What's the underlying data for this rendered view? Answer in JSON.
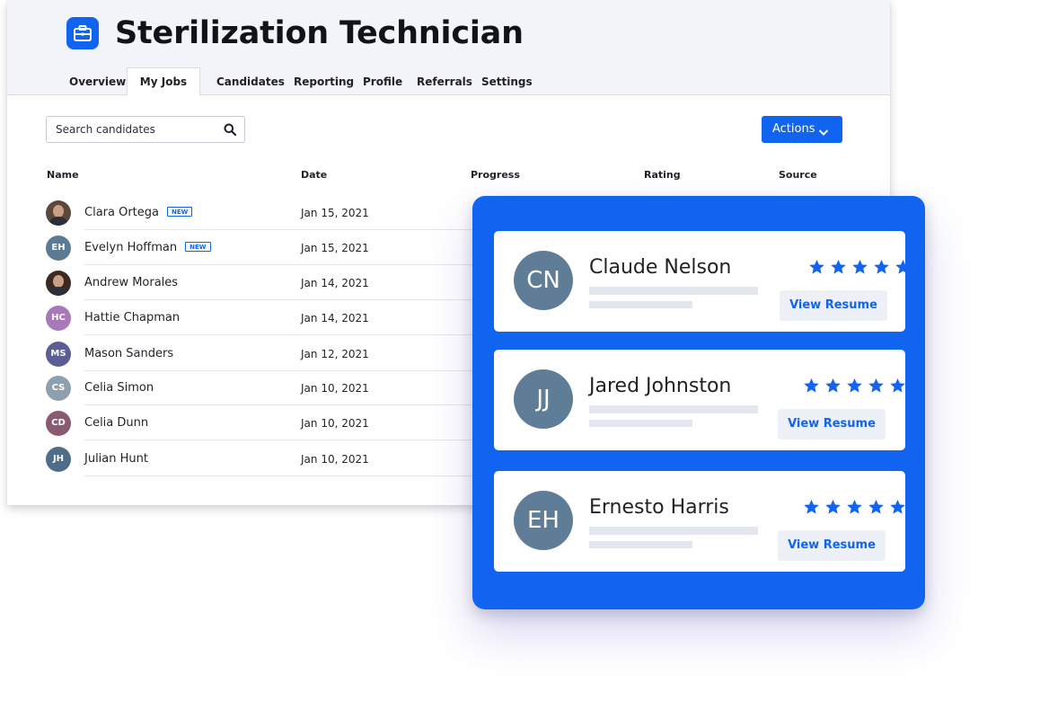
{
  "header": {
    "title": "Sterilization Technician",
    "icon": "briefcase-icon",
    "brand_color": "#1064f0"
  },
  "tabs": [
    {
      "label": "Overview",
      "active": false
    },
    {
      "label": "My Jobs",
      "active": true
    },
    {
      "label": "Candidates",
      "active": false
    },
    {
      "label": "Reporting",
      "active": false
    },
    {
      "label": "Profile",
      "active": false
    },
    {
      "label": "Referrals",
      "active": false
    },
    {
      "label": "Settings",
      "active": false
    }
  ],
  "search": {
    "placeholder": "Search candidates",
    "icon": "search-icon"
  },
  "actions": {
    "label": "Actions",
    "icon": "chevron-down-icon"
  },
  "table": {
    "columns": [
      "Name",
      "Date",
      "Progress",
      "Rating",
      "Source"
    ],
    "badge_label": "NEW",
    "rows": [
      {
        "name": "Clara Ortega",
        "initials": "",
        "new": true,
        "date": "Jan 15, 2021",
        "color": "#5b4a3c",
        "photo": true
      },
      {
        "name": "Evelyn Hoffman",
        "initials": "EH",
        "new": true,
        "date": "Jan 15, 2021",
        "color": "#5d7a94",
        "photo": false
      },
      {
        "name": "Andrew Morales",
        "initials": "",
        "new": false,
        "date": "Jan 14, 2021",
        "color": "#3b2a22",
        "photo": true
      },
      {
        "name": "Hattie Chapman",
        "initials": "HC",
        "new": false,
        "date": "Jan 14, 2021",
        "color": "#a878b8",
        "photo": false
      },
      {
        "name": "Mason Sanders",
        "initials": "MS",
        "new": false,
        "date": "Jan 12, 2021",
        "color": "#5a5e94",
        "photo": false
      },
      {
        "name": "Celia Simon",
        "initials": "CS",
        "new": false,
        "date": "Jan 10, 2021",
        "color": "#8e9fae",
        "photo": false
      },
      {
        "name": "Celia Dunn",
        "initials": "CD",
        "new": false,
        "date": "Jan 10, 2021",
        "color": "#8a5a73",
        "photo": false
      },
      {
        "name": "Julian Hunt",
        "initials": "JH",
        "new": false,
        "date": "Jan 10, 2021",
        "color": "#4f6c8a",
        "photo": false
      }
    ]
  },
  "cards": [
    {
      "initials": "CN",
      "name": "Claude Nelson",
      "rating": 5,
      "button": "View Resume"
    },
    {
      "initials": "JJ",
      "name": "Jared Johnston",
      "rating": 5,
      "button": "View Resume"
    },
    {
      "initials": "EH",
      "name": "Ernesto Harris",
      "rating": 5,
      "button": "View Resume"
    }
  ]
}
